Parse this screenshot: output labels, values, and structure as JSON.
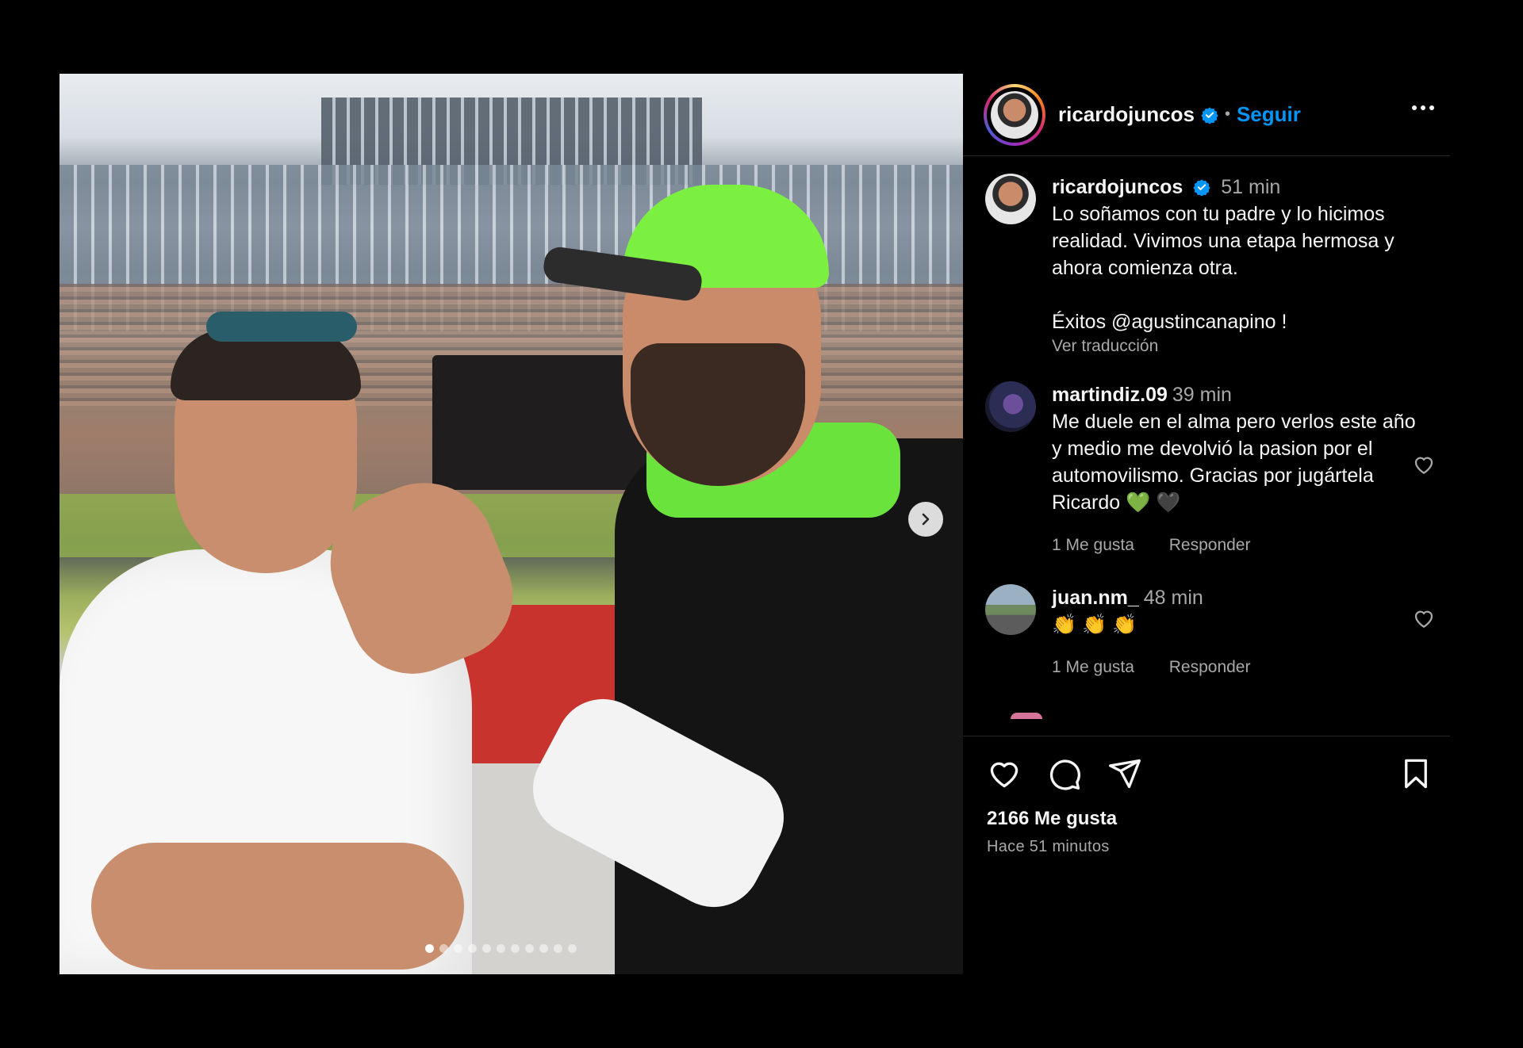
{
  "post": {
    "author": "ricardojuncos",
    "follow_label": "Seguir",
    "separator": "•",
    "caption": {
      "user": "ricardojuncos",
      "time": "51 min",
      "text": "Lo soñamos con tu padre y lo hicimos realidad. Vivimos una etapa hermosa y ahora comienza otra.",
      "text2": "Éxitos @agustincanapino !",
      "translate_label": "Ver traducción"
    },
    "comments": [
      {
        "user": "martindiz.09",
        "time": "39 min",
        "text": "Me duele en el alma pero verlos este año y medio me devolvió la pasion por el automovilismo. Gracias por jugártela Ricardo 💚 🖤",
        "likes": "1 Me gusta",
        "reply": "Responder"
      },
      {
        "user": "juan.nm_",
        "time": "48 min",
        "text": "👏 👏 👏",
        "likes": "1 Me gusta",
        "reply": "Responder"
      }
    ],
    "likes_count": "2166 Me gusta",
    "posted_ago": "Hace 51 minutos",
    "carousel": {
      "total": 11,
      "active": 1
    }
  },
  "colors": {
    "accent": "#0095f6",
    "bg": "#000000",
    "muted": "#a8a8a8"
  }
}
